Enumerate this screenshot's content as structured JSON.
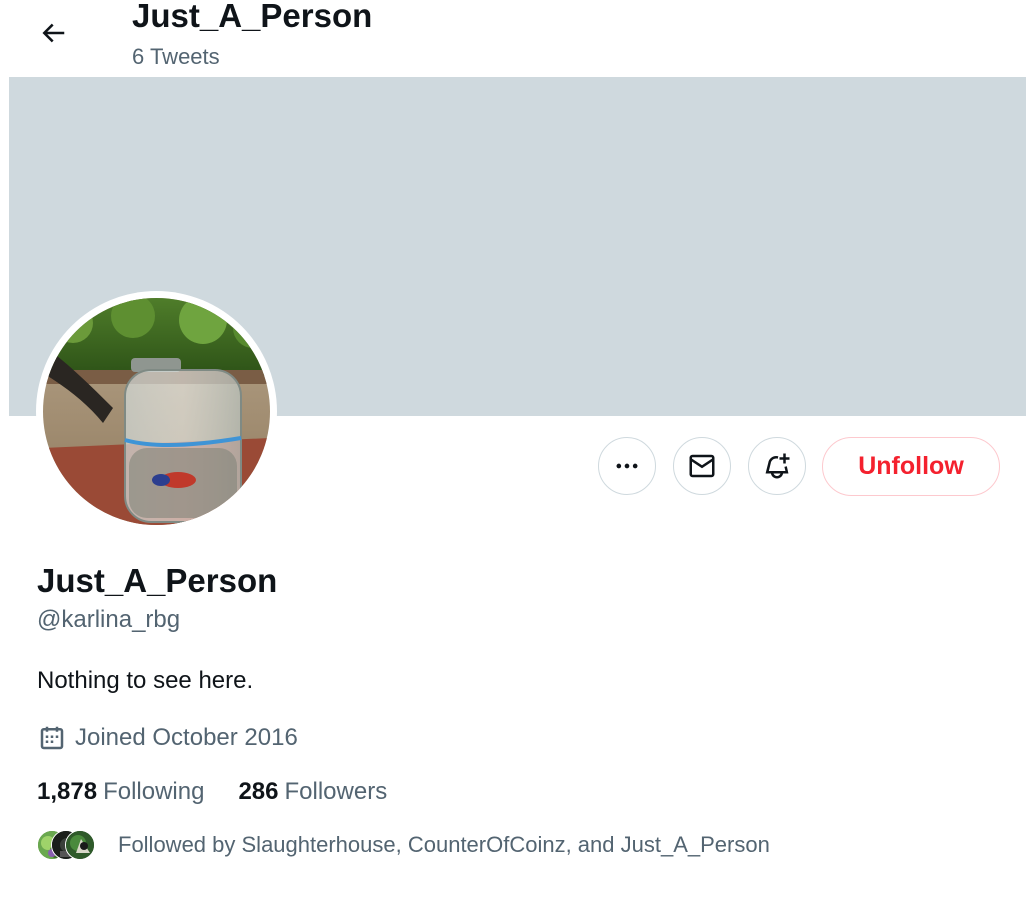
{
  "header": {
    "title": "Just_A_Person",
    "subtitle": "6 Tweets"
  },
  "icons": {
    "back": "arrow-left-icon",
    "more": "more-horizontal-icon",
    "message": "mail-icon",
    "notify": "bell-plus-icon",
    "calendar": "calendar-icon"
  },
  "actions": {
    "unfollow_label": "Unfollow"
  },
  "profile": {
    "display_name": "Just_A_Person",
    "handle": "@karlina_rbg",
    "bio": "Nothing to see here.",
    "joined": "Joined October 2016"
  },
  "stats": {
    "following_count": "1,878",
    "following_label": "Following",
    "followers_count": "286",
    "followers_label": "Followers"
  },
  "followed_by": {
    "text": "Followed by Slaughterhouse, CounterOfCoinz, and Just_A_Person"
  },
  "colors": {
    "banner": "#cfd9de",
    "accent_red": "#f4212e",
    "secondary_text": "#536471",
    "primary_text": "#0f1419"
  }
}
